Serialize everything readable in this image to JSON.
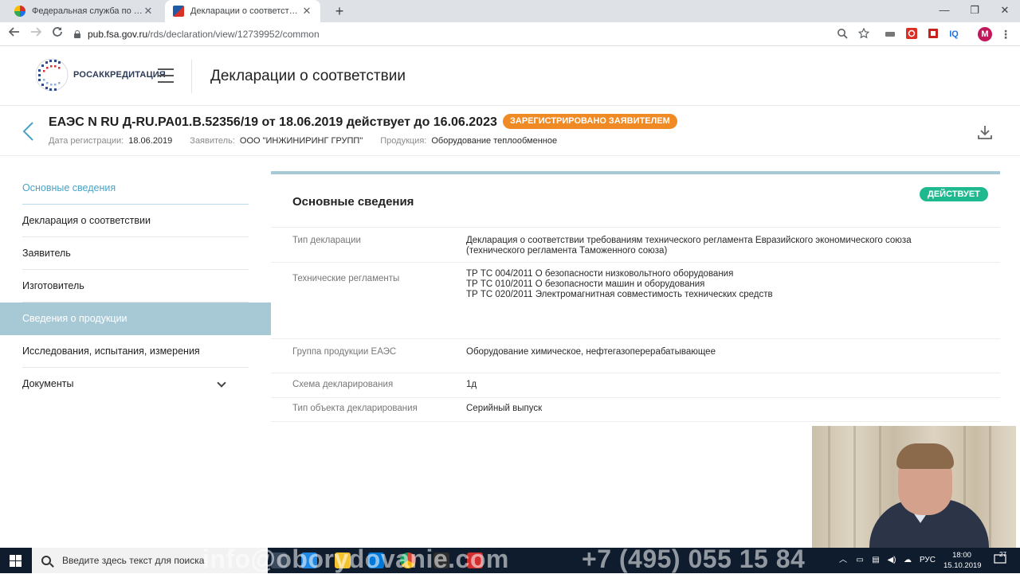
{
  "browser": {
    "tabs": [
      {
        "title": "Федеральная служба по аккред"
      },
      {
        "title": "Декларации о соответствии"
      }
    ],
    "new_tab_label": "+",
    "close_label": "✕",
    "url_host": "pub.fsa.gov.ru",
    "url_path": "/rds/declaration/view/12739952/common",
    "window_controls": {
      "minimize": "—",
      "maximize": "❐",
      "close": "✕"
    },
    "extensions": [
      "zoom-icon",
      "bookmark-star-icon",
      "extension-icon",
      "extension-icon",
      "extension-icon",
      "iq-extension-icon",
      "profile-avatar-icon",
      "menu-icon"
    ],
    "ext_iq_label": "IQ",
    "profile_initial": "M",
    "menu_label": "⋮"
  },
  "site": {
    "logo_text": "РОСАККРЕДИТАЦИЯ",
    "page_title": "Декларации о соответствии"
  },
  "declaration": {
    "title": "ЕАЭС N RU Д-RU.PA01.B.52356/19 от 18.06.2019 действует до 16.06.2023",
    "registration_badge": "ЗАРЕГИСТРИРОВАНО ЗАЯВИТЕЛЕМ",
    "meta": {
      "reg_date_label": "Дата регистрации:",
      "reg_date": "18.06.2019",
      "applicant_label": "Заявитель:",
      "applicant": "ООО \"ИНЖИНИРИНГ ГРУПП\"",
      "product_label": "Продукция:",
      "product": "Оборудование теплообменное"
    }
  },
  "sidebar": {
    "items": [
      {
        "label": "Основные сведения"
      },
      {
        "label": "Декларация о соответствии"
      },
      {
        "label": "Заявитель"
      },
      {
        "label": "Изготовитель"
      },
      {
        "label": "Сведения о продукции"
      },
      {
        "label": "Исследования, испытания, измерения"
      },
      {
        "label": "Документы"
      }
    ]
  },
  "main": {
    "section_title": "Основные сведения",
    "status": "ДЕЙСТВУЕТ",
    "rows": {
      "decl_type_label": "Тип декларации",
      "decl_type_line1": "Декларация о соответствии требованиям технического регламента Евразийского экономического союза",
      "decl_type_line2": "(технического регламента Таможенного союза)",
      "regs_label": "Технические регламенты",
      "regs": [
        "ТР ТС 004/2011 О безопасности низковольтного оборудования",
        "ТР ТС 010/2011 О безопасности машин и оборудования",
        "ТР ТС 020/2011 Электромагнитная совместимость технических средств"
      ],
      "group_label": "Группа продукции ЕАЭС",
      "group": "Оборудование химическое, нефтегазоперерабатывающее",
      "scheme_label": "Схема декларирования",
      "scheme": "1д",
      "object_label": "Тип объекта декларирования",
      "object": "Серийный выпуск"
    }
  },
  "taskbar": {
    "search_placeholder": "Введите здесь текст для поиска",
    "lang": "РУС",
    "time": "18:00",
    "date": "15.10.2019",
    "notifications": "27"
  },
  "overlay": {
    "email": "info@oborydovanie.com",
    "phone": "+7 (495) 055 15 84"
  }
}
